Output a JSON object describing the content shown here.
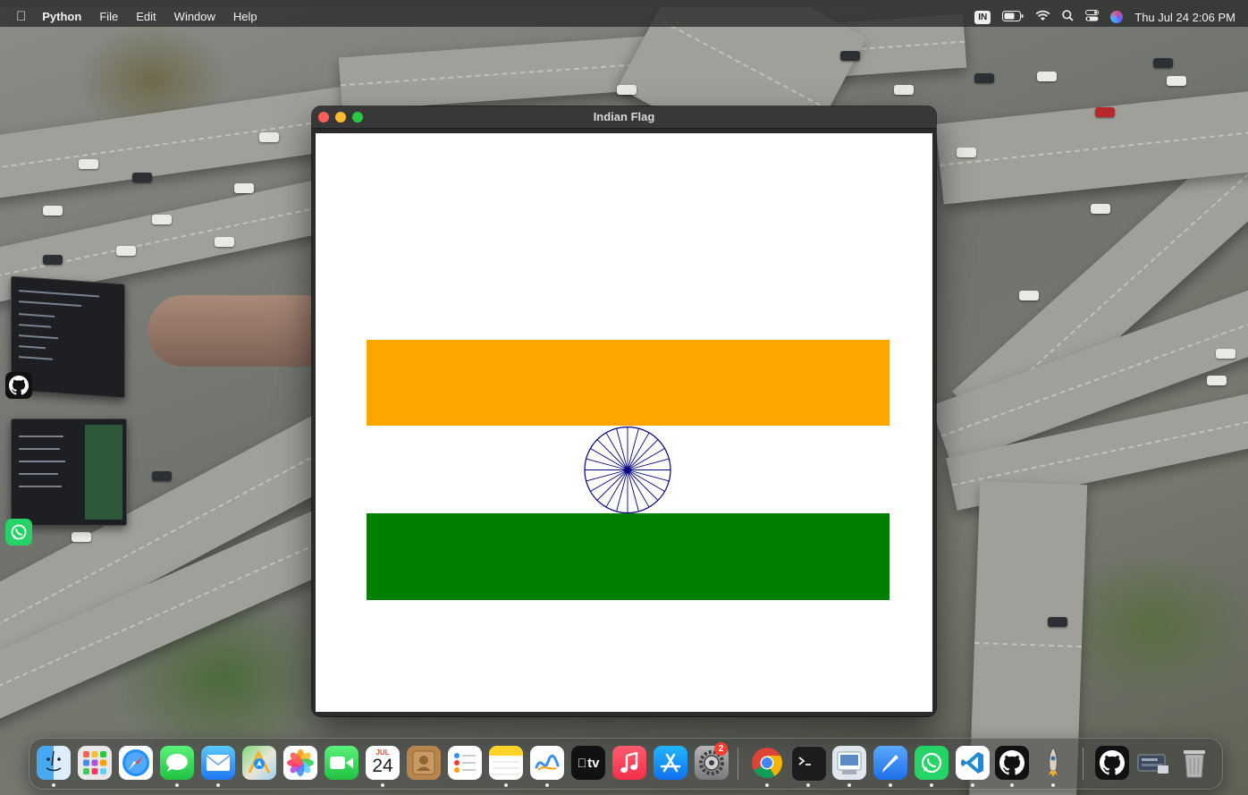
{
  "menubar": {
    "app_name": "Python",
    "items": [
      "File",
      "Edit",
      "Window",
      "Help"
    ],
    "input_source": "IN",
    "clock": "Thu Jul 24  2:06 PM"
  },
  "window": {
    "title": "Indian Flag",
    "flag": {
      "saffron": "#FFA500",
      "white": "#FFFFFF",
      "green": "#008000",
      "chakra": "#000080",
      "chakra_spokes": 24
    }
  },
  "dock": {
    "calendar_month": "JUL",
    "calendar_day": "24",
    "tv_label": "tv",
    "settings_badge": "2",
    "apps": [
      "Finder",
      "Launchpad",
      "Safari",
      "Messages",
      "Mail",
      "Maps",
      "Photos",
      "FaceTime",
      "Calendar",
      "Contacts",
      "Reminders",
      "Notes",
      "Freeform",
      "TV",
      "Music",
      "App Store",
      "System Settings",
      "Chrome",
      "Terminal",
      "Preview",
      "Pages",
      "WhatsApp",
      "VS Code",
      "GitHub Desktop",
      "Python Launcher",
      "GitHub",
      "Screenshot",
      "Trash"
    ]
  }
}
